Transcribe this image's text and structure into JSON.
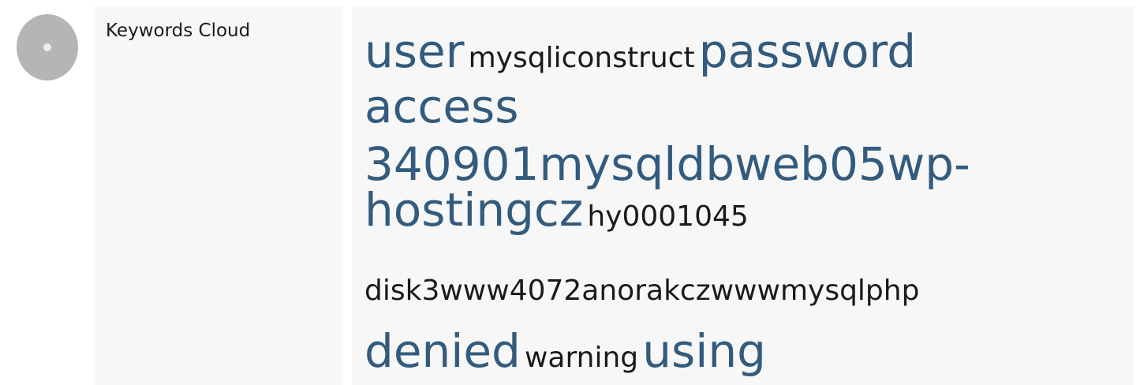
{
  "section": {
    "label": "Keywords Cloud",
    "icon": "disc-icon"
  },
  "colors": {
    "keyword_highlight": "#335b7d",
    "keyword_normal": "#1a1a1a",
    "cell_background": "#f7f7f7"
  },
  "keywords": [
    {
      "text": "user",
      "style": "highlight"
    },
    {
      "text": "mysqliconstruct",
      "style": "normal"
    },
    {
      "text": "password",
      "style": "highlight"
    },
    {
      "text": "access",
      "style": "highlight"
    },
    {
      "text": "340901mysqldbweb05wp-hostingcz",
      "style": "highlight"
    },
    {
      "text": "hy0001045",
      "style": "normal"
    },
    {
      "text": "disk3www4072anorakczwwwmysqlphp",
      "style": "normal"
    },
    {
      "text": "denied",
      "style": "highlight"
    },
    {
      "text": "warning",
      "style": "normal"
    },
    {
      "text": "using",
      "style": "highlight"
    }
  ]
}
